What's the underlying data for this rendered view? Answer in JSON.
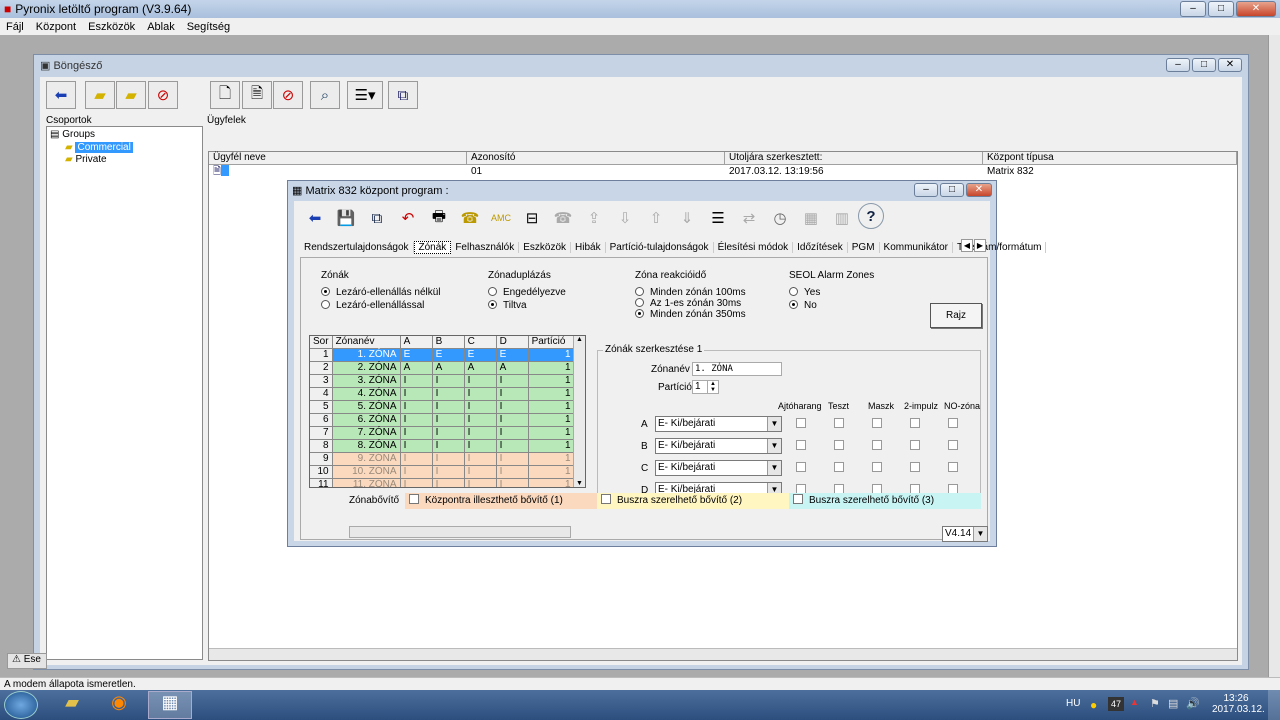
{
  "app": {
    "title": "Pyronix letöltő program (V3.9.64)"
  },
  "menu": [
    "Fájl",
    "Központ",
    "Eszközök",
    "Ablak",
    "Segítség"
  ],
  "browser": {
    "title": "Böngésző",
    "groups_label": "Csoportok",
    "clients_label": "Ügyfelek",
    "tree": {
      "root": "Groups",
      "items": [
        "Commercial",
        "Private"
      ]
    },
    "columns": [
      "Ügyfél neve",
      "Azonosító",
      "Utoljára szerkesztett:",
      "Központ típusa"
    ],
    "rows": [
      {
        "name": "",
        "id": "01",
        "edited": "2017.03.12. 13:19:56",
        "type": "Matrix 832"
      }
    ],
    "bottom_tab": "Ese"
  },
  "dialog": {
    "title": "Matrix 832 központ program :",
    "tabs": [
      "Rendszertulajdonságok",
      "Zónák",
      "Felhasználók",
      "Eszközök",
      "Hibák",
      "Partíció-tulajdonságok",
      "Élesítési módok",
      "Időzítések",
      "PGM",
      "Kommunikátor",
      "Tel.szám/formátum"
    ],
    "active_tab": "Zónák",
    "zones_group": {
      "label": "Zónák",
      "options": [
        "Lezáró-ellenállás nélkül",
        "Lezáró-ellenállással"
      ],
      "selected": 0
    },
    "dup_group": {
      "label": "Zónaduplázás",
      "options": [
        "Engedélyezve",
        "Tiltva"
      ],
      "selected": 1
    },
    "reaction_group": {
      "label": "Zóna reakcióidő",
      "options": [
        "Minden zónán 100ms",
        "Az 1-es zónán 30ms",
        "Minden zónán 350ms"
      ],
      "selected": 2
    },
    "seol_group": {
      "label": "SEOL Alarm Zones",
      "options": [
        "Yes",
        "No"
      ],
      "selected": 1
    },
    "draw_button": "Rajz",
    "grid": {
      "headers": [
        "Sor",
        "Zónanév",
        "A",
        "B",
        "C",
        "D",
        "Partíció"
      ],
      "rows": [
        [
          "1",
          "1. ZÓNA",
          "E",
          "E",
          "E",
          "E",
          "1"
        ],
        [
          "2",
          "2. ZÓNA",
          "A",
          "A",
          "A",
          "A",
          "1"
        ],
        [
          "3",
          "3. ZÓNA",
          "I",
          "I",
          "I",
          "I",
          "1"
        ],
        [
          "4",
          "4. ZÓNA",
          "I",
          "I",
          "I",
          "I",
          "1"
        ],
        [
          "5",
          "5. ZÓNA",
          "I",
          "I",
          "I",
          "I",
          "1"
        ],
        [
          "6",
          "6. ZÓNA",
          "I",
          "I",
          "I",
          "I",
          "1"
        ],
        [
          "7",
          "7. ZÓNA",
          "I",
          "I",
          "I",
          "I",
          "1"
        ],
        [
          "8",
          "8. ZÓNA",
          "I",
          "I",
          "I",
          "I",
          "1"
        ],
        [
          "9",
          "9. ZÓNA",
          "I",
          "I",
          "I",
          "I",
          "1"
        ],
        [
          "10",
          "10. ZÓNA",
          "I",
          "I",
          "I",
          "I",
          "1"
        ],
        [
          "11",
          "11. ZÓNA",
          "I",
          "I",
          "I",
          "I",
          "1"
        ]
      ]
    },
    "edit": {
      "label": "Zónák szerkesztése 1",
      "name_label": "Zónanév",
      "name_value": "1. ZÓNA",
      "partition_label": "Partíció",
      "partition_value": "1",
      "flag_headers": [
        "Ajtóharang",
        "Teszt",
        "Maszk",
        "2-impulz",
        "NO-zóna"
      ],
      "rows": [
        {
          "letter": "A",
          "mode": "E- Ki/bejárati"
        },
        {
          "letter": "B",
          "mode": "E- Ki/bejárati"
        },
        {
          "letter": "C",
          "mode": "E- Ki/bejárati"
        },
        {
          "letter": "D",
          "mode": "E- Ki/bejárati"
        }
      ]
    },
    "expanders": {
      "label": "Zónabővítő",
      "items": [
        "Központra illeszthető bővítő (1)",
        "Buszra szerelhető bővítő (2)",
        "Buszra szerelhető bővítő (3)"
      ]
    },
    "version": "V4.14"
  },
  "status": {
    "text": "A modem állapota ismeretlen."
  },
  "tray": {
    "lang": "HU",
    "time": "13:26",
    "date": "2017.03.12.",
    "badge": "47"
  },
  "colors": {
    "green": "#b8e8b8",
    "peach": "#fad9bf",
    "yellow": "#fff6c2",
    "cyan": "#c8f4f4",
    "selected": "#3399ff"
  }
}
